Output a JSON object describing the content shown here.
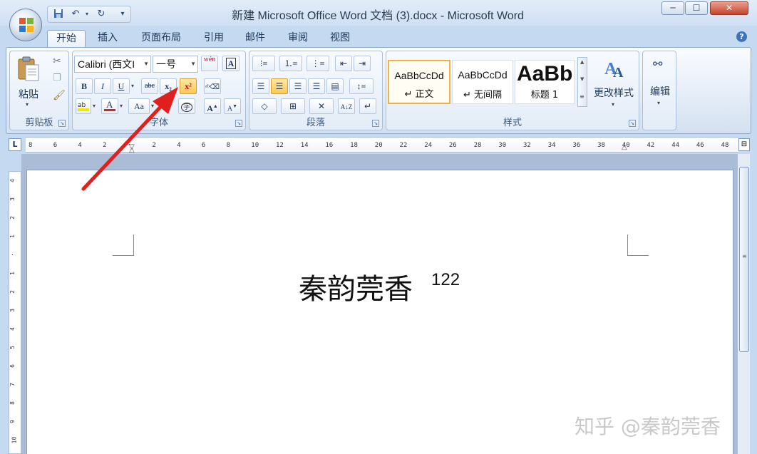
{
  "window": {
    "title": "新建 Microsoft Office Word 文档 (3).docx - Microsoft Word",
    "minimize": "─",
    "maximize": "☐",
    "close": "✕"
  },
  "qat": {
    "save_icon": "save-icon",
    "undo_icon": "undo-icon",
    "redo_icon": "redo-icon",
    "customize": "▾"
  },
  "tabs": [
    {
      "label": "开始",
      "active": true
    },
    {
      "label": "插入"
    },
    {
      "label": "页面布局"
    },
    {
      "label": "引用"
    },
    {
      "label": "邮件"
    },
    {
      "label": "审阅"
    },
    {
      "label": "视图"
    }
  ],
  "help": "?",
  "clipboard": {
    "paste_label": "粘贴",
    "group_label": "剪贴板"
  },
  "font": {
    "font_name": "Calibri (西文I",
    "font_size": "一号",
    "wen_label": "wén",
    "bold": "B",
    "italic": "I",
    "underline": "U",
    "strike": "abc",
    "subscript": "x₂",
    "superscript": "x²",
    "grow": "A",
    "shrink": "A",
    "case": "Aa",
    "group_label": "字体"
  },
  "paragraph": {
    "group_label": "段落"
  },
  "styles": {
    "items": [
      {
        "sample": "AaBbCcDd",
        "name": "↵ 正文",
        "selected": true
      },
      {
        "sample": "AaBbCcDd",
        "name": "↵ 无间隔"
      },
      {
        "sample": "AaBb",
        "name": "标题 1"
      }
    ],
    "change_label": "更改样式",
    "group_label": "样式"
  },
  "editing": {
    "label": "编辑"
  },
  "ruler": {
    "corner": "L",
    "h_ticks": [
      "8",
      "6",
      "4",
      "2",
      "",
      "2",
      "4",
      "6",
      "8",
      "10",
      "12",
      "14",
      "16",
      "18",
      "20",
      "22",
      "24",
      "26",
      "28",
      "30",
      "32",
      "34",
      "36",
      "38",
      "40",
      "42",
      "44",
      "46",
      "48"
    ],
    "v_ticks": [
      "4",
      "3",
      "2",
      "1",
      "",
      "1",
      "2",
      "3",
      "4",
      "5",
      "6",
      "7",
      "8",
      "9",
      "10"
    ]
  },
  "document": {
    "text": "秦韵莞香",
    "superscript": "122"
  },
  "watermark": "知乎 @秦韵莞香",
  "colors": {
    "highlight": "#f1e80a",
    "font_color": "#e01f1f",
    "arrow": "#e0201c",
    "accent": "#2b579a"
  }
}
